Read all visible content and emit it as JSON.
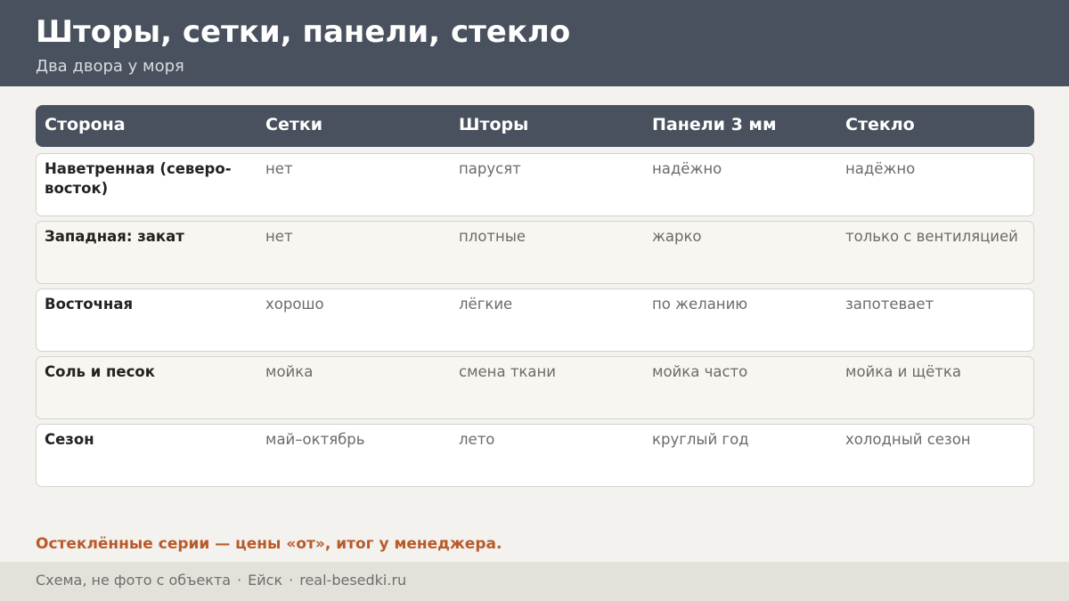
{
  "header": {
    "title": "Шторы, сетки, панели, стекло",
    "subtitle": "Два двора у моря"
  },
  "table": {
    "columns": [
      "Сторона",
      "Сетки",
      "Шторы",
      "Панели 3 мм",
      "Стекло"
    ],
    "rows": [
      {
        "side": "Наветренная (северо-восток)",
        "nets": "нет",
        "curtains": "парусят",
        "panels": "надёжно",
        "glass": "надёжно"
      },
      {
        "side": "Западная: закат",
        "nets": "нет",
        "curtains": "плотные",
        "panels": "жарко",
        "glass": "только с вентиляцией"
      },
      {
        "side": "Восточная",
        "nets": "хорошо",
        "curtains": "лёгкие",
        "panels": "по желанию",
        "glass": "запотевает"
      },
      {
        "side": "Соль и песок",
        "nets": "мойка",
        "curtains": "смена ткани",
        "panels": "мойка часто",
        "glass": "мойка и щётка"
      },
      {
        "side": "Сезон",
        "nets": "май–октябрь",
        "curtains": "лето",
        "panels": "круглый год",
        "glass": "холодный сезон"
      }
    ]
  },
  "note": "Остеклённые серии — цены «от», итог у менеджера.",
  "footer": {
    "items": [
      "Схема, не фото с объекта",
      "Ейск",
      "real-besedki.ru"
    ],
    "separator": "·"
  },
  "colors": {
    "header_bg": "#48515d",
    "page_bg": "#f4f2ee",
    "accent": "#b85a2a",
    "footer_bg": "#e4e1da"
  }
}
